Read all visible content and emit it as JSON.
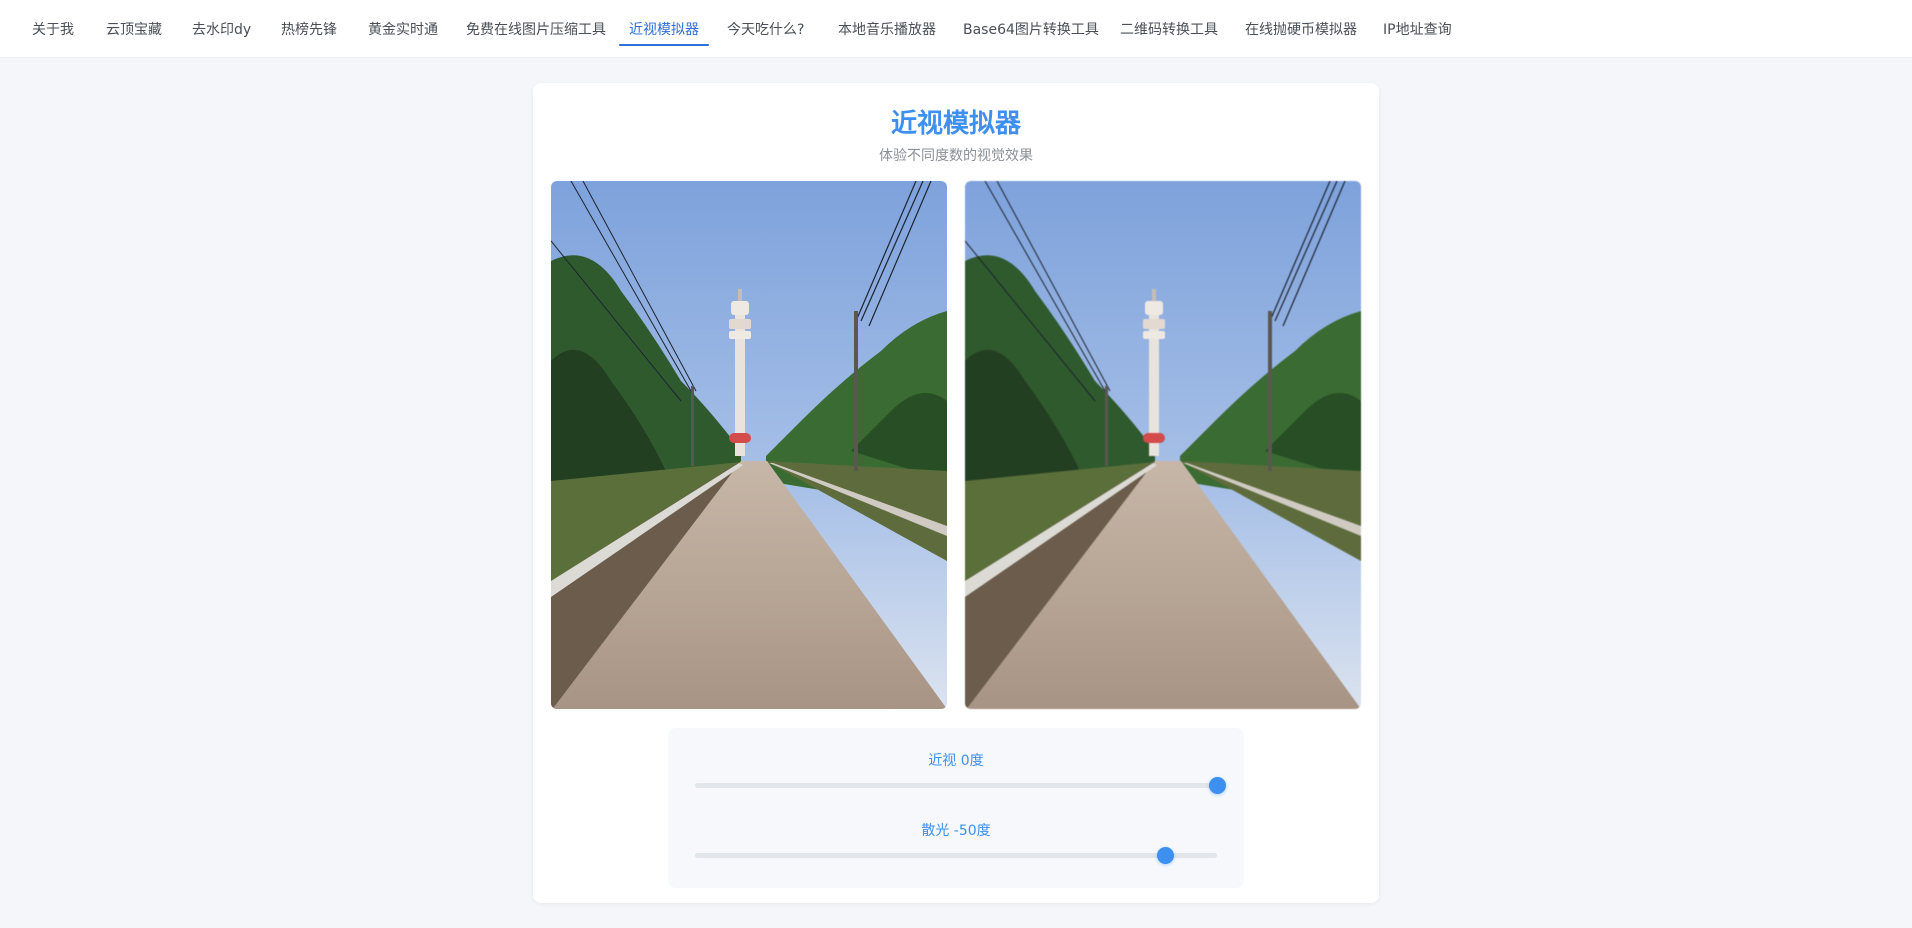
{
  "nav": {
    "tabs": [
      {
        "label": "关于我"
      },
      {
        "label": "云顶宝藏"
      },
      {
        "label": "去水印dy"
      },
      {
        "label": "热榜先锋"
      },
      {
        "label": "黄金实时通"
      },
      {
        "label": "免费在线图片压缩工具"
      },
      {
        "label": "近视模拟器"
      },
      {
        "label": "今天吃什么?"
      },
      {
        "label": "本地音乐播放器"
      },
      {
        "label": "Base64图片转换工具"
      },
      {
        "label": "二维码转换工具"
      },
      {
        "label": "在线抛硬币模拟器"
      },
      {
        "label": "IP地址查询"
      }
    ],
    "active_index": 6,
    "accent_color": "#2f6fd9"
  },
  "main": {
    "title": "近视模拟器",
    "subtitle": "体验不同度数的视觉效果",
    "images": [
      {
        "name": "original-photo",
        "description_icon": "road-tower-photo"
      },
      {
        "name": "simulated-photo",
        "description_icon": "road-tower-photo"
      }
    ]
  },
  "controls": {
    "myopia": {
      "label": "近视 0度",
      "level_fraction": 1.0
    },
    "astigmatism": {
      "label": "散光 -50度",
      "level_fraction": 0.9
    }
  },
  "colors": {
    "accent": "#3d8ff0",
    "background": "#f4f6f9",
    "card": "#ffffff"
  }
}
